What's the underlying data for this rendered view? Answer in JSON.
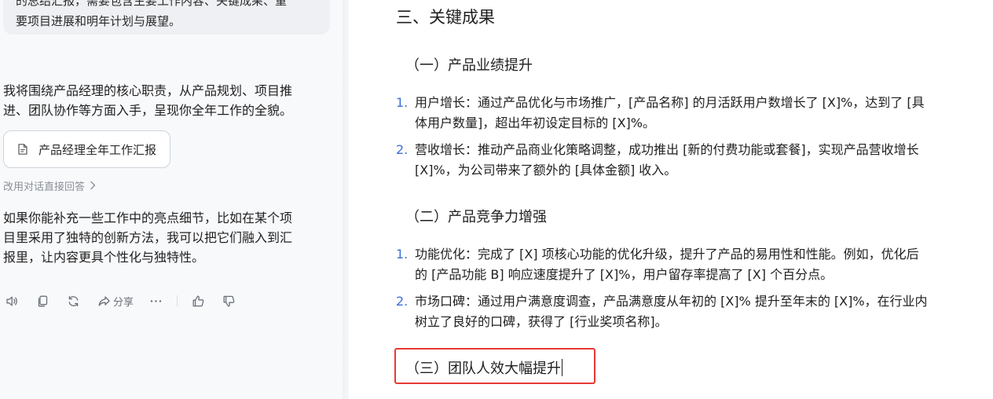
{
  "chat": {
    "user_message_lines": [
      "的总结汇报，需要包含主要工作内容、关键成果、重",
      "要项目进展和明年计划与展望。"
    ],
    "reply_intro_lines": [
      "我将围绕产品经理的核心职责，从产品规划、项目推",
      "进、团队协作等方面入手，呈现你全年工作的全貌。"
    ],
    "doc_card_label": "产品经理全年工作汇报",
    "direct_answer_label": "改用对话直接回答",
    "reply_followup_lines": [
      "如果你能补充一些工作中的亮点细节，比如在某个项",
      "目里采用了独特的创新方法，我可以把它们融入到汇",
      "报里，让内容更具个性化与独特性。"
    ],
    "actions": {
      "share_label": "分享",
      "icons": [
        "speaker-icon",
        "copy-icon",
        "regenerate-icon",
        "share-icon",
        "more-icon",
        "thumbs-up-icon",
        "thumbs-down-icon"
      ]
    }
  },
  "document": {
    "section_title": "三、关键成果",
    "subsections": [
      {
        "title": "（一）产品业绩提升",
        "items": [
          {
            "num": "1.",
            "lines": [
              "用户增长：通过产品优化与市场推广，[产品名称] 的月活跃用户数增长了 [X]%，达到了 [具",
              "体用户数量]，超出年初设定目标的 [X]%。"
            ]
          },
          {
            "num": "2.",
            "lines": [
              "营收增长：推动产品商业化策略调整，成功推出 [新的付费功能或套餐]，实现产品营收增长",
              "[X]%，为公司带来了额外的 [具体金额] 收入。"
            ]
          }
        ]
      },
      {
        "title": "（二）产品竞争力增强",
        "items": [
          {
            "num": "1.",
            "lines": [
              "功能优化：完成了 [X] 项核心功能的优化升级，提升了产品的易用性和性能。例如，优化后",
              "的 [产品功能 B] 响应速度提升了 [X]%，用户留存率提高了 [X] 个百分点。"
            ]
          },
          {
            "num": "2.",
            "lines": [
              "市场口碑：通过用户满意度调查，产品满意度从年初的 [X]% 提升至年末的 [X]%，在行业内",
              "树立了良好的口碑，获得了 [行业奖项名称]。"
            ]
          }
        ]
      },
      {
        "title": "（三）团队人效大幅提升"
      }
    ]
  },
  "colors": {
    "list_number": "#3b6fd8",
    "highlight_border": "#e53935",
    "muted_text": "#8a8f98"
  }
}
